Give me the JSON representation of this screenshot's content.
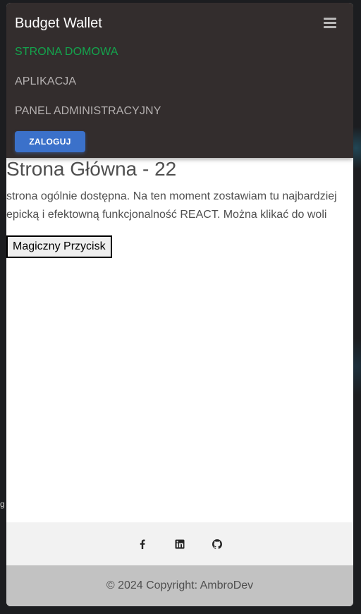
{
  "navbar": {
    "brand": "Budget Wallet",
    "menu_icon": "hamburger-menu-icon",
    "links": [
      {
        "label": "STRONA DOMOWA",
        "active": true
      },
      {
        "label": "APLIKACJA",
        "active": false
      },
      {
        "label": "PANEL ADMINISTRACYJNY",
        "active": false
      }
    ],
    "login_label": "ZALOGUJ"
  },
  "main": {
    "title": "Strona Główna - 22",
    "description": "strona ogólnie dostępna. Na ten moment zostawiam tu najbardziej epicką i efektowną funkcjonalność REACT. Można klikać do woli",
    "button_label": "Magiczny Przycisk"
  },
  "background": {
    "stray_text": "g"
  },
  "footer": {
    "social_icons": [
      "facebook-icon",
      "linkedin-icon",
      "github-icon"
    ],
    "copyright": "© 2024 Copyright: AmbroDev"
  },
  "colors": {
    "navbar_bg": "#332d2d",
    "active_link": "#14a44d",
    "inactive_link": "#b4b0b0",
    "primary_button": "#3b71ca",
    "text": "#4f4f4f",
    "footer_social_bg": "#f2f2f2",
    "footer_copy_bg": "#c2c2c2"
  }
}
